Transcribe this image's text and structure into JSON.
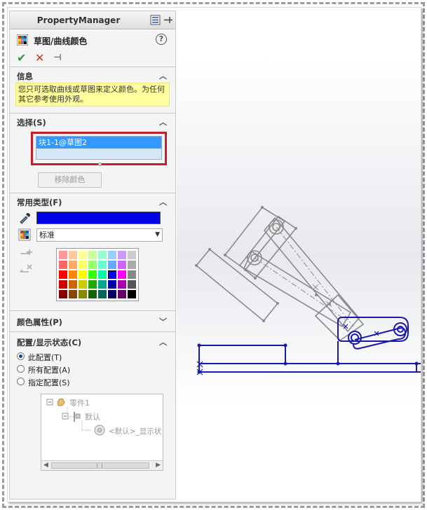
{
  "panel": {
    "header_title": "PropertyManager",
    "feature_name": "草图/曲线颜色",
    "help_glyph": "?",
    "actions": {
      "ok": "✔",
      "cancel": "✕",
      "pin": "⊣"
    }
  },
  "sections": {
    "info": {
      "title": "信息",
      "text": "您只可选取曲线或草图来定义颜色。为任何其它参考使用外观。"
    },
    "selection": {
      "title": "选择(S)",
      "items": [
        "块1-1@草图2"
      ],
      "remove_button": "移除颜色"
    },
    "common_types": {
      "title": "常用类型(F)",
      "current_color": "#0000e6",
      "standard_select": "标准"
    },
    "color_props": {
      "title": "颜色属性(P)"
    },
    "config": {
      "title": "配置/显示状态(C)",
      "options": [
        {
          "label": "此配置(T)",
          "selected": true
        },
        {
          "label": "所有配置(A)",
          "selected": false
        },
        {
          "label": "指定配置(S)",
          "selected": false
        }
      ],
      "tree": {
        "root": "零件1",
        "child": "默认",
        "leaf": "<默认>_显示状"
      }
    }
  },
  "palette_colors": [
    "#ff9999",
    "#ffcc99",
    "#ffff99",
    "#ccff99",
    "#99ffcc",
    "#99ccff",
    "#cc99ff",
    "#cccccc",
    "#ff6666",
    "#ffaa66",
    "#ffff66",
    "#99ff66",
    "#66ffcc",
    "#66aaff",
    "#cc66ff",
    "#aaaaaa",
    "#ff0000",
    "#ff8800",
    "#ffff00",
    "#33ff00",
    "#00ffaa",
    "#0000ff",
    "#ff00ff",
    "#888888",
    "#cc0000",
    "#cc6600",
    "#cccc00",
    "#22aa00",
    "#00aa88",
    "#0000aa",
    "#aa00aa",
    "#555555",
    "#880000",
    "#884400",
    "#888800",
    "#116600",
    "#006655",
    "#000066",
    "#660066",
    "#000000"
  ],
  "colors": {
    "sketch_highlight": "#1a1aaa",
    "sketch_gray": "#8a8a8a",
    "highlight_frame": "#c8202a"
  }
}
